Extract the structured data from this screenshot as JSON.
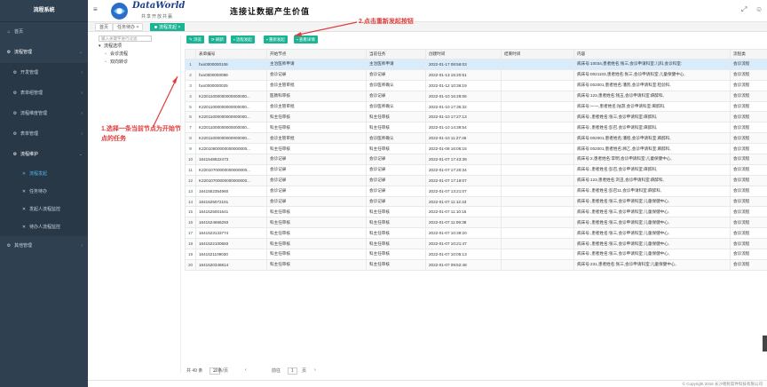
{
  "sidebar": {
    "title": "流程系统",
    "items": [
      {
        "label": "首页",
        "icon": "home-icon"
      },
      {
        "label": "流程管理",
        "icon": "gear-icon"
      },
      {
        "label": "开发管理",
        "icon": "gear-icon"
      },
      {
        "label": "表单组管理",
        "icon": "gear-icon"
      },
      {
        "label": "流程维度管理",
        "icon": "gear-icon"
      },
      {
        "label": "表单管理",
        "icon": "gear-icon"
      },
      {
        "label": "流程维护",
        "icon": "gear-icon"
      },
      {
        "label": "流程发起",
        "icon": "wrench-icon"
      },
      {
        "label": "任务待办",
        "icon": "wrench-icon"
      },
      {
        "label": "发起人流程监控",
        "icon": "wrench-icon"
      },
      {
        "label": "待办人流程监控",
        "icon": "wrench-icon"
      },
      {
        "label": "其他管理",
        "icon": "gear-icon"
      }
    ]
  },
  "header": {
    "brand": "DataWorld",
    "brand_sub": "共享开放共赢",
    "slogan": "连接让数据产生价值"
  },
  "tabs": [
    {
      "label": "首页"
    },
    {
      "label": "任务待办 ×"
    },
    {
      "label": "流程发起 ×"
    }
  ],
  "tree": {
    "search_placeholder": "输入关键字进行过滤",
    "root": "流程选项",
    "children": [
      "会诊流程",
      "双向转诊"
    ]
  },
  "toolbar": {
    "buttons": [
      "浏览",
      "刷新",
      "流程发起",
      "重新发起",
      "查看详情"
    ]
  },
  "table": {
    "columns": [
      "",
      "表单编号",
      "开始节点",
      "当前任务",
      "创建时间",
      "结束时间",
      "内容",
      "流程类"
    ],
    "rows": [
      [
        "1",
        "hxx0000000106",
        "主治医师申请",
        "主治医师申请",
        "2022-01-17 08:56:03",
        "",
        "病床号:10034,患者姓名:张三,会诊申请科室:儿科,会诊科室:",
        "会诊流程"
      ],
      [
        "2",
        "hxx0000000099",
        "会诊记录",
        "会诊记录",
        "2022-01-13 15:20:51",
        "",
        "病床号:0021103,患者姓名:张三,会诊申请科室:儿童保健中心,",
        "会诊流程"
      ],
      [
        "3",
        "hxx0000000025",
        "会诊主管审批",
        "会诊医师确认",
        "2022-01-12 10:36:19",
        "",
        "病床号:002001,患者姓名:潘凯,会诊申请科室:检验科,",
        "会诊流程"
      ],
      [
        "4",
        "K22011000000000000000...",
        "医教科审核",
        "会诊记录",
        "2022-01-10 16:28:06",
        "",
        "病床号:123,患者姓名:钱五,会诊申请科室:麻醉科,",
        "会诊流程"
      ],
      [
        "5",
        "K22011000000000000000...",
        "会诊主管审批",
        "会诊医师确认",
        "2022-01-10 17:35:32",
        "",
        "病床号:一一,患者姓名:陆游,会诊申请科室:麻醉科,",
        "会诊流程"
      ],
      [
        "6",
        "K22011000000000000000...",
        "科主任审核",
        "科主任审核",
        "2022-01-10 17:27:13",
        "",
        "病床号:,患者姓名:张三,会诊申请科室:麻醉科,",
        "会诊流程"
      ],
      [
        "7",
        "K22011000000000000000...",
        "科主任审核",
        "科主任审核",
        "2022-01-10 14:39:54",
        "",
        "病床号:,患者姓名:彭召,会诊申请科室:麻醉科,",
        "会诊流程"
      ],
      [
        "8",
        "K22011000000000000000...",
        "会诊主管审批",
        "会诊医师确认",
        "2022-01-10 11:27:46",
        "",
        "病床号:002001,患者姓名:潘程,会诊申请科室:麻醉科,",
        "会诊流程"
      ],
      [
        "9",
        "K22010800000000000000...",
        "科主任审核",
        "科主任审核",
        "2022-01-08 16:06:15",
        "",
        "病床号:002001,患者姓名:顾乙,会诊申请科室:麻醉科,",
        "会诊流程"
      ],
      [
        "10",
        "1641548622473",
        "会诊记录",
        "会诊记录",
        "2022-01-07 17:43:39",
        "",
        "病床号:2,患者姓名:李明,会诊申请科室:儿童保健中心,",
        "会诊流程"
      ],
      [
        "11",
        "K22010700000000000000...",
        "会诊记录",
        "会诊记录",
        "2022-01-07 17:20:34",
        "",
        "病床号:,患者姓名:彭召,会诊申请科室:麻醉科,",
        "会诊流程"
      ],
      [
        "12",
        "K22010700000000000000...",
        "会诊记录",
        "会诊记录",
        "2022-01-07 17:19:07",
        "",
        "病床号:123,患者姓名:刘丑,会诊申请科室:麻醉科,",
        "会诊流程"
      ],
      [
        "13",
        "1641552354960",
        "会诊记录",
        "会诊记录",
        "2022-01-07 13:21:07",
        "",
        "病床号:,患者姓名:彭召11,会诊申请科室:麻醉科,",
        "会诊流程"
      ],
      [
        "14",
        "1641525072161",
        "会诊记录",
        "会诊记录",
        "2022-01-07 11:12:43",
        "",
        "病床号:,患者姓名:张三,会诊申请科室:儿童保健中心,",
        "会诊流程"
      ],
      [
        "15",
        "1641525001641",
        "科主任审核",
        "科主任审核",
        "2022-01-07 11:10:15",
        "",
        "病床号:,患者姓名:张三,会诊申请科室:儿童保健中心,",
        "会诊流程"
      ],
      [
        "16",
        "1641524666293",
        "科主任审核",
        "科主任审核",
        "2022-01-07 11:09:38",
        "",
        "病床号:,患者姓名:张三,会诊申请科室:儿童保健中心,",
        "会诊流程"
      ],
      [
        "17",
        "1641523133774",
        "科主任审核",
        "科主任审核",
        "2022-01-07 10:39:20",
        "",
        "病床号:,患者姓名:张三,会诊申请科室:儿童保健中心,",
        "会诊流程"
      ],
      [
        "18",
        "1641522100683",
        "科主任审核",
        "科主任审核",
        "2022-01-07 10:21:47",
        "",
        "病床号:,患者姓名:张三,会诊申请科室:儿童保健中心,",
        "会诊流程"
      ],
      [
        "19",
        "1641521109030",
        "科主任审核",
        "科主任审核",
        "2022-01-07 10:05:13",
        "",
        "病床号:,患者姓名:张三,会诊申请科室:儿童保健中心,",
        "会诊流程"
      ],
      [
        "20",
        "1641520346814",
        "科主任审核",
        "科主任审核",
        "2022-01-07 09:52:48",
        "",
        "病床号:231,患者姓名:张三,会诊申请科室:儿童保健中心,",
        "会诊流程"
      ]
    ]
  },
  "pager": {
    "total": "共 49 条",
    "page_size": "20条/页",
    "prev": "‹",
    "goto_label": "前往",
    "page": "1",
    "page_unit": "页",
    "next": "›"
  },
  "footer": "© Copyright 2016 长沙德民软件科技有限公司",
  "annotations": {
    "step1": "1.选择一条当前节点为开始节点的任务",
    "step2": "2.点击重新发起按钮",
    "color": "#e23b3b"
  }
}
